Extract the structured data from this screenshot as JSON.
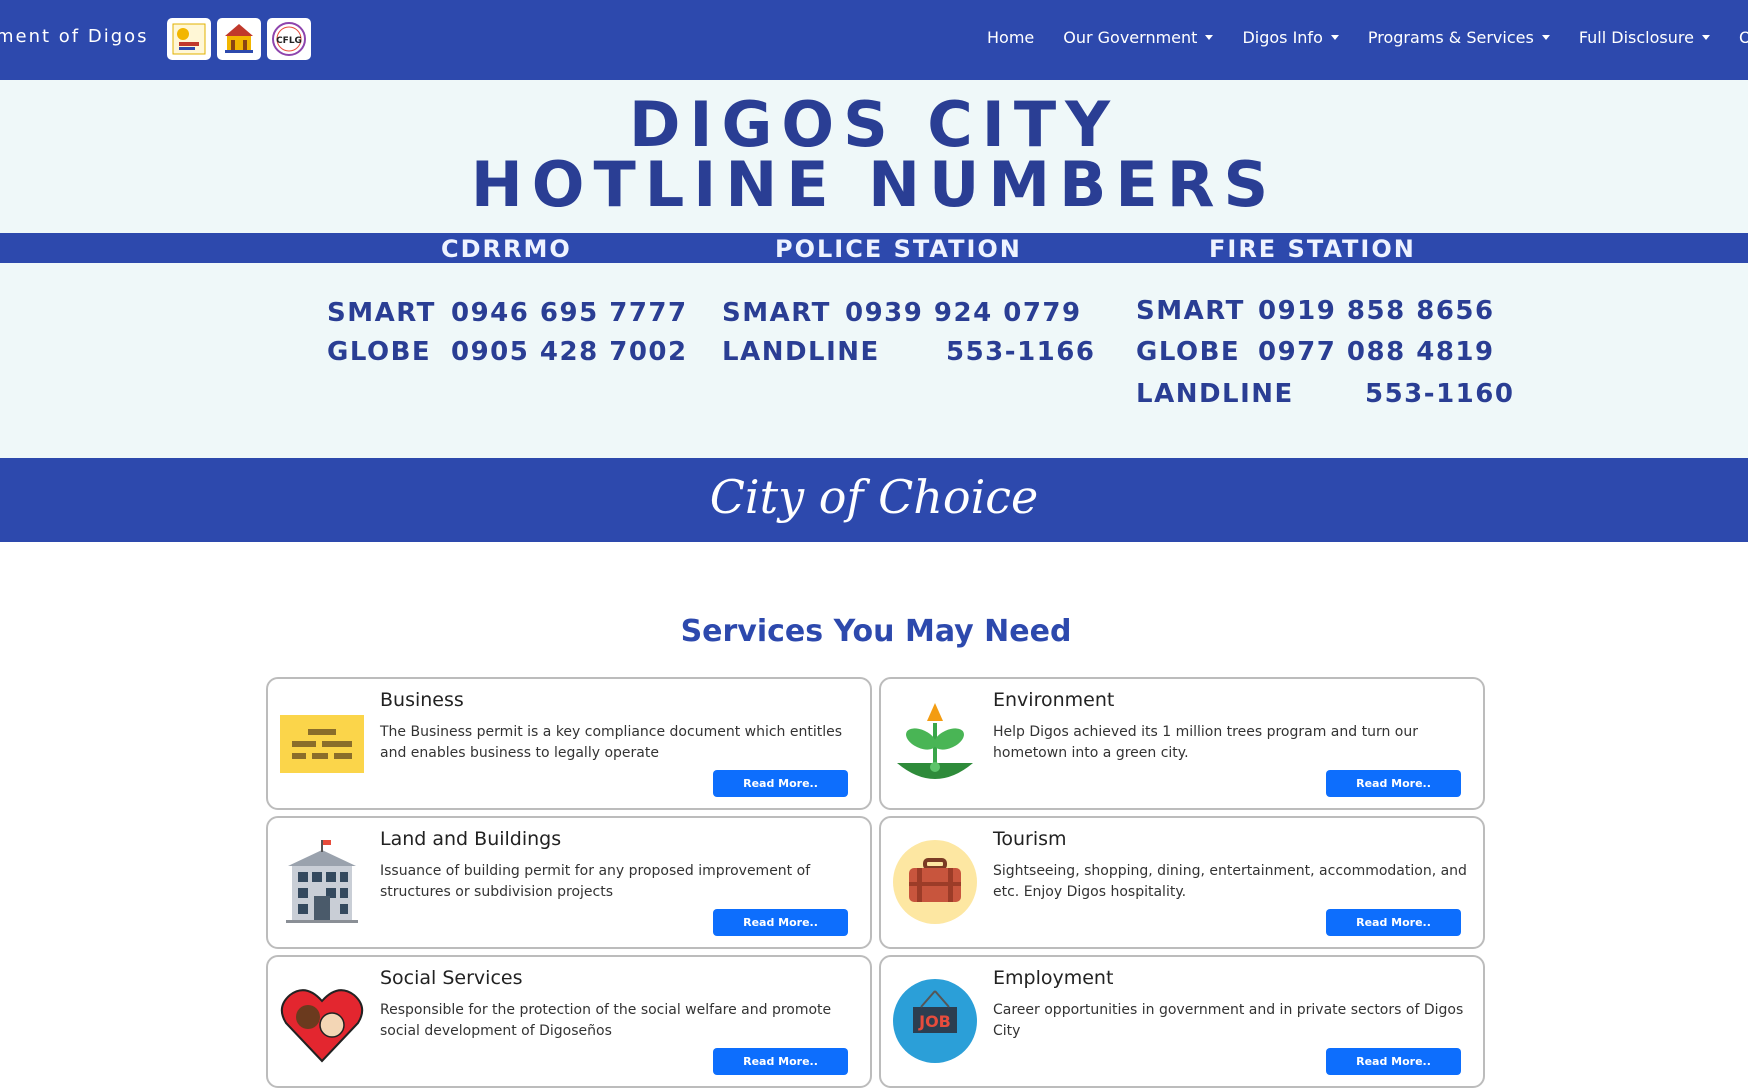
{
  "nav": {
    "brand": "ment of Digos",
    "items": [
      {
        "label": "Home",
        "dropdown": false
      },
      {
        "label": "Our Government",
        "dropdown": true
      },
      {
        "label": "Digos Info",
        "dropdown": true
      },
      {
        "label": "Programs & Services",
        "dropdown": true
      },
      {
        "label": "Full Disclosure",
        "dropdown": true
      },
      {
        "label": "Ord",
        "dropdown": false
      }
    ],
    "logo_labels": [
      "",
      "",
      "CFLG"
    ]
  },
  "banner": {
    "title_line1": "DIGOS CITY",
    "title_line2": "HOTLINE NUMBERS",
    "columns": [
      {
        "heading": "CDRRMO",
        "lines": [
          {
            "carrier": "SMART",
            "number": "0946 695 7777"
          },
          {
            "carrier": "GLOBE",
            "number": "0905 428 7002"
          }
        ]
      },
      {
        "heading": "POLICE STATION",
        "lines": [
          {
            "carrier": "SMART",
            "number": "0939 924 0779"
          },
          {
            "carrier": "LANDLINE",
            "number": "553-1166"
          }
        ]
      },
      {
        "heading": "FIRE STATION",
        "lines": [
          {
            "carrier": "SMART",
            "number": "0919 858 8656"
          },
          {
            "carrier": "GLOBE",
            "number": "0977 088 4819"
          },
          {
            "carrier": "LANDLINE",
            "number": "553-1160"
          }
        ]
      }
    ],
    "slogan": "City of Choice"
  },
  "services": {
    "title": "Services You May Need",
    "read_more": "Read More..",
    "cards": [
      {
        "title": "Business",
        "desc": "The Business permit is a key compliance document which entitles and enables business to legally operate",
        "icon": "business-permit-icon"
      },
      {
        "title": "Environment",
        "desc": "Help Digos achieved its 1 million trees program and turn our hometown into a green city.",
        "icon": "seedling-icon"
      },
      {
        "title": "Land and Buildings",
        "desc": "Issuance of building permit for any proposed improvement of structures or subdivision projects",
        "icon": "building-icon"
      },
      {
        "title": "Tourism",
        "desc": "Sightseeing, shopping, dining, entertainment, accommodation, and etc. Enjoy Digos hospitality.",
        "icon": "suitcase-icon"
      },
      {
        "title": "Social Services",
        "desc": "Responsible for the protection of the social welfare and promote social development of Digoseños",
        "icon": "heart-hands-icon"
      },
      {
        "title": "Employment",
        "desc": "Career opportunities in government and in private sectors of Digos City",
        "icon": "job-sign-icon"
      }
    ]
  },
  "colors": {
    "primary": "#2d49ad",
    "button": "#0d6efd",
    "banner_bg": "#eff8f9",
    "title_text": "#2a3e94"
  }
}
